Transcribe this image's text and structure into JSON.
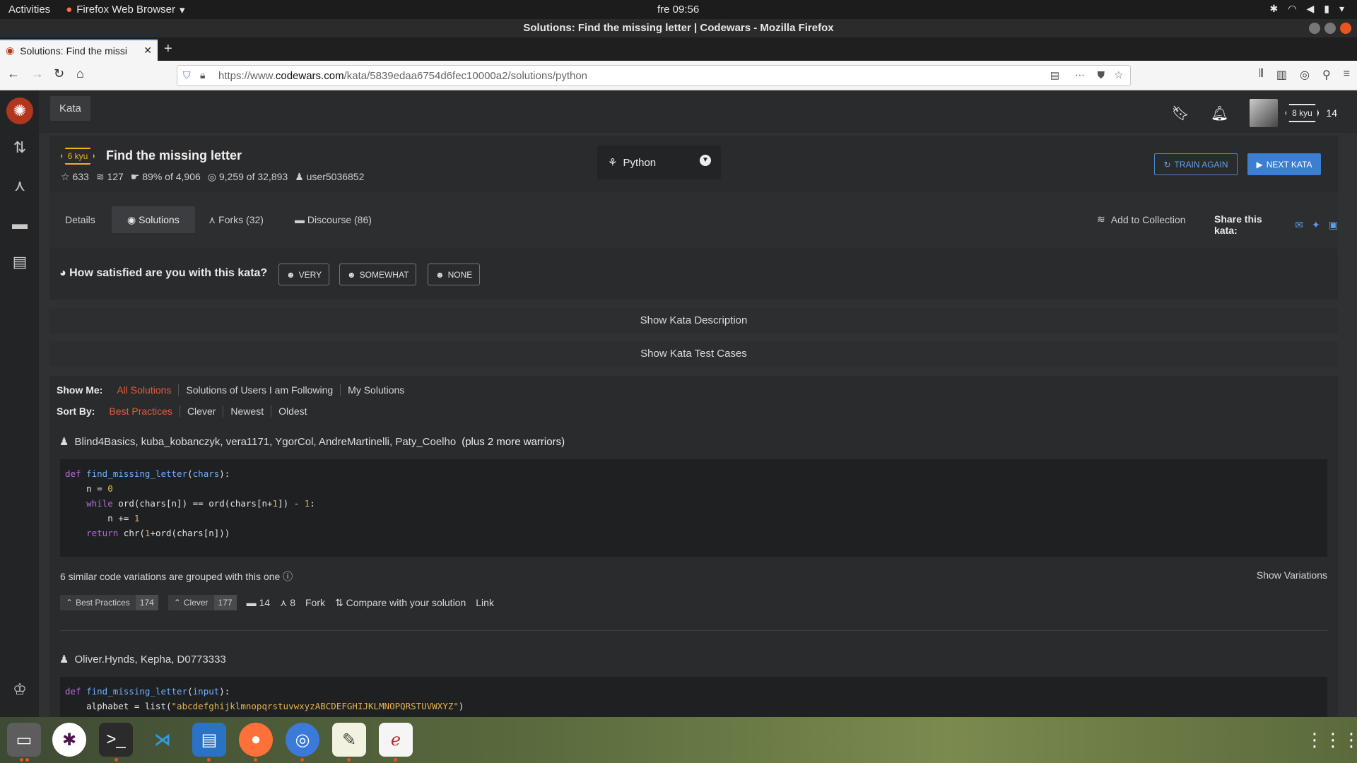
{
  "os": {
    "activities": "Activities",
    "app_menu": "Firefox Web Browser",
    "clock": "fre 09:56"
  },
  "window": {
    "title": "Solutions: Find the missing letter | Codewars - Mozilla Firefox"
  },
  "browser": {
    "tab_title": "Solutions: Find the missi",
    "url_prefix": "https://www.",
    "url_host": "codewars.com",
    "url_rest": "/kata/5839edaa6754d6fec10000a2/solutions/python"
  },
  "header": {
    "kata_tab": "Kata",
    "rank": "8 kyu",
    "honor": "14"
  },
  "kata": {
    "rank": "6 kyu",
    "title": "Find the missing letter",
    "stars": "633",
    "collections": "127",
    "satisfaction": "89% of 4,906",
    "completed": "9,259 of 32,893",
    "author": "user5036852",
    "language": "Python",
    "train_again": "TRAIN AGAIN",
    "next_kata": "NEXT KATA"
  },
  "tabs": {
    "details": "Details",
    "solutions": "Solutions",
    "forks": "Forks (32)",
    "discourse": "Discourse (86)",
    "add_collection": "Add to Collection",
    "share": "Share this kata:"
  },
  "satisfaction": {
    "question": "How satisfied are you with this kata?",
    "very": "VERY",
    "somewhat": "SOMEWHAT",
    "none": "NONE"
  },
  "bars": {
    "description": "Show Kata Description",
    "tests": "Show Kata Test Cases"
  },
  "filters": {
    "show_me_label": "Show Me:",
    "show_me": [
      "All Solutions",
      "Solutions of Users I am Following",
      "My Solutions"
    ],
    "sort_by_label": "Sort By:",
    "sort_by": [
      "Best Practices",
      "Clever",
      "Newest",
      "Oldest"
    ]
  },
  "solution1": {
    "warriors": "Blind4Basics, kuba_kobanczyk, vera1171, YgorCol, AndreMartinelli, Paty_Coelho",
    "more": "(plus 2 more warriors)",
    "variations": "6 similar code variations are grouped with this one",
    "show_variations": "Show Variations",
    "best_practices": "Best Practices",
    "best_practices_count": "174",
    "clever": "Clever",
    "clever_count": "177",
    "comments": "14",
    "forks": "8",
    "fork": "Fork",
    "compare": "Compare with your solution",
    "link": "Link"
  },
  "solution2": {
    "warriors": "Oliver.Hynds, Kepha, D0773333"
  },
  "colors": {
    "accent_red": "#e45c3c",
    "rank_yellow": "#ecb613",
    "button_blue": "#3c7ed1"
  }
}
